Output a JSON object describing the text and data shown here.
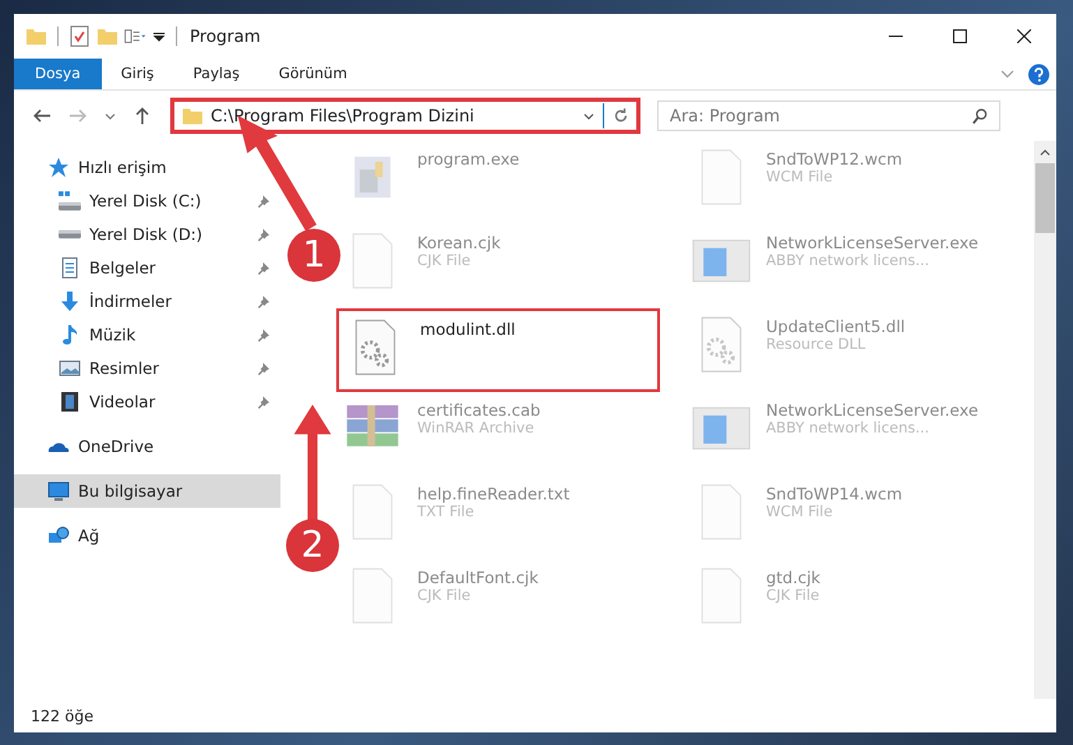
{
  "window": {
    "title": "Program"
  },
  "ribbon_tabs": [
    {
      "label": "Dosya",
      "selected": true
    },
    {
      "label": "Giriş",
      "selected": false
    },
    {
      "label": "Paylaş",
      "selected": false
    },
    {
      "label": "Görünüm",
      "selected": false
    }
  ],
  "address": {
    "path": "C:\\Program Files\\Program Dizini",
    "highlighted": true
  },
  "search": {
    "placeholder": "Ara: Program"
  },
  "sidebar": {
    "items": [
      {
        "label": "Hızlı erişim",
        "kind": "star",
        "selected": false,
        "children": [
          {
            "label": "Yerel Disk (C:)",
            "kind": "drive-c",
            "pinned": true,
            "selected": false
          },
          {
            "label": "Yerel Disk (D:)",
            "kind": "drive",
            "pinned": true,
            "selected": false
          },
          {
            "label": "Belgeler",
            "kind": "document",
            "pinned": true,
            "selected": false
          },
          {
            "label": "İndirmeler",
            "kind": "download",
            "pinned": true,
            "selected": false
          },
          {
            "label": "Müzik",
            "kind": "music",
            "pinned": true,
            "selected": false
          },
          {
            "label": "Resimler",
            "kind": "picture",
            "pinned": true,
            "selected": false
          },
          {
            "label": "Videolar",
            "kind": "video",
            "pinned": true,
            "selected": false
          }
        ]
      },
      {
        "label": "OneDrive",
        "kind": "cloud",
        "selected": false
      },
      {
        "label": "Bu bilgisayar",
        "kind": "computer",
        "selected": true
      },
      {
        "label": "Ağ",
        "kind": "network",
        "selected": false
      }
    ]
  },
  "files": [
    {
      "name": "program.exe",
      "kind": "installer",
      "blurred": true,
      "highlighted": false
    },
    {
      "name": "SndToWP12.wcm",
      "type": "WCM File",
      "kind": "blank",
      "blurred": true,
      "highlighted": false
    },
    {
      "name": "Korean.cjk",
      "type": "CJK File",
      "kind": "blank",
      "blurred": true,
      "highlighted": false
    },
    {
      "name": "NetworkLicenseServer.exe",
      "type": "ABBY network licens...",
      "kind": "app",
      "blurred": true,
      "highlighted": false
    },
    {
      "name": "modulint.dll",
      "kind": "gears",
      "blurred": false,
      "highlighted": true
    },
    {
      "name": "UpdateClient5.dll",
      "type": "Resource DLL",
      "kind": "gears",
      "blurred": true,
      "highlighted": false
    },
    {
      "name": "certificates.cab",
      "type": "WinRAR Archive",
      "kind": "archive",
      "blurred": true,
      "highlighted": false
    },
    {
      "name": "NetworkLicenseServer.exe",
      "type": "ABBY network licens...",
      "kind": "app",
      "blurred": true,
      "highlighted": false
    },
    {
      "name": "help.fineReader.txt",
      "type": "TXT File",
      "kind": "blank",
      "blurred": true,
      "highlighted": false
    },
    {
      "name": "SndToWP14.wcm",
      "type": "WCM File",
      "kind": "blank",
      "blurred": true,
      "highlighted": false
    },
    {
      "name": "DefaultFont.cjk",
      "type": "CJK File",
      "kind": "blank",
      "blurred": true,
      "highlighted": false
    },
    {
      "name": "gtd.cjk",
      "type": "CJK File",
      "kind": "blank",
      "blurred": true,
      "highlighted": false
    }
  ],
  "annotations": [
    {
      "label": "1"
    },
    {
      "label": "2"
    }
  ],
  "status_bar": "122 öğe"
}
